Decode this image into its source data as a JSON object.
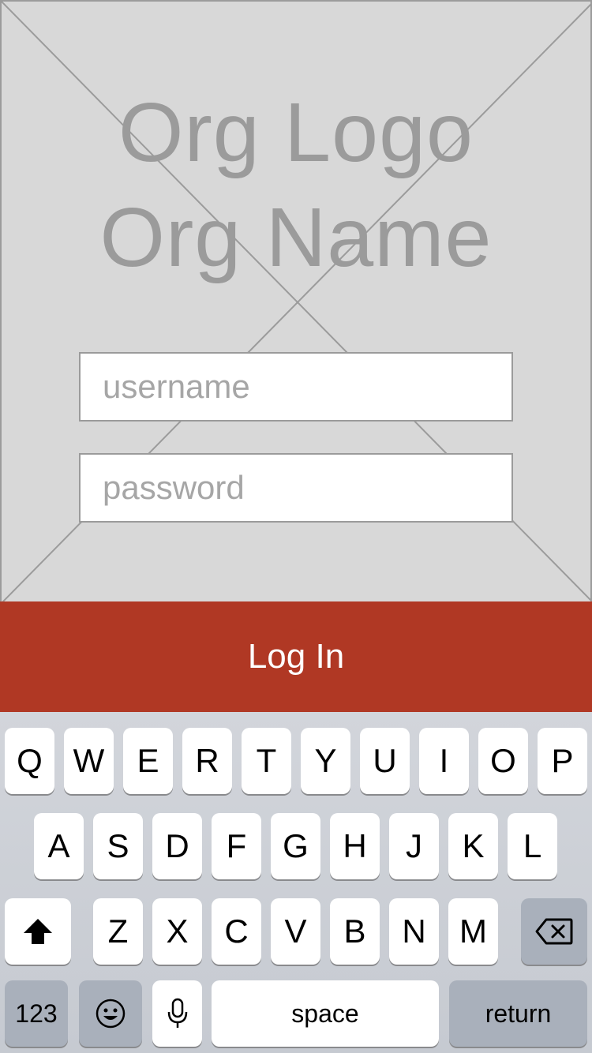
{
  "branding": {
    "logo_text": "Org Logo",
    "name_text": "Org Name"
  },
  "form": {
    "username_placeholder": "username",
    "password_placeholder": "password",
    "login_label": "Log In"
  },
  "colors": {
    "accent": "#b03824",
    "placeholder_bg": "#d8d8d8",
    "placeholder_stroke": "#9b9b9b",
    "keyboard_bg": "#d2d5db",
    "key_dark": "#a9b0bb"
  },
  "keyboard": {
    "row1": [
      "Q",
      "W",
      "E",
      "R",
      "T",
      "Y",
      "U",
      "I",
      "O",
      "P"
    ],
    "row2": [
      "A",
      "S",
      "D",
      "F",
      "G",
      "H",
      "J",
      "K",
      "L"
    ],
    "row3": [
      "Z",
      "X",
      "C",
      "V",
      "B",
      "N",
      "M"
    ],
    "shift_icon": "shift-icon",
    "delete_icon": "backspace-icon",
    "numbers_label": "123",
    "emoji_icon": "emoji-icon",
    "mic_icon": "microphone-icon",
    "space_label": "space",
    "return_label": "return"
  }
}
